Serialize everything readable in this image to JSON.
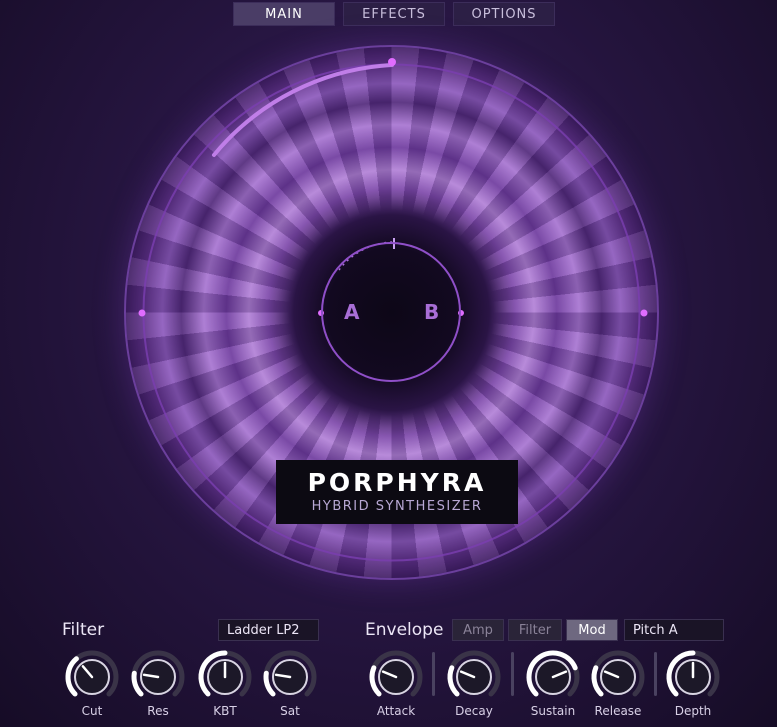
{
  "tabs": [
    {
      "label": "MAIN",
      "active": true
    },
    {
      "label": "EFFECTS",
      "active": false
    },
    {
      "label": "OPTIONS",
      "active": false
    }
  ],
  "visual": {
    "ab_left": "A",
    "ab_right": "B",
    "logo_title": "PORPHYRA",
    "logo_subtitle": "HYBRID SYNTHESIZER"
  },
  "filter": {
    "label": "Filter",
    "type": "Ladder LP2",
    "knobs": [
      {
        "label": "Cut",
        "value": 0.35
      },
      {
        "label": "Res",
        "value": 0.2
      },
      {
        "label": "KBT",
        "value": 0.5
      },
      {
        "label": "Sat",
        "value": 0.2
      }
    ]
  },
  "envelope": {
    "label": "Envelope",
    "tabs": [
      {
        "label": "Amp",
        "active": false
      },
      {
        "label": "Filter",
        "active": false
      },
      {
        "label": "Mod",
        "active": true
      }
    ],
    "target": "Pitch A",
    "knobs": [
      {
        "label": "Attack",
        "value": 0.25
      },
      {
        "label": "Decay",
        "value": 0.25
      },
      {
        "label": "Sustain",
        "value": 0.75
      },
      {
        "label": "Release",
        "value": 0.25
      },
      {
        "label": "Depth",
        "value": 0.5
      }
    ]
  },
  "colors": {
    "accent": "#a86ed6",
    "ring": "#8f4fc8",
    "knob_track": "#3a3448",
    "knob_fill": "#ffffff"
  }
}
